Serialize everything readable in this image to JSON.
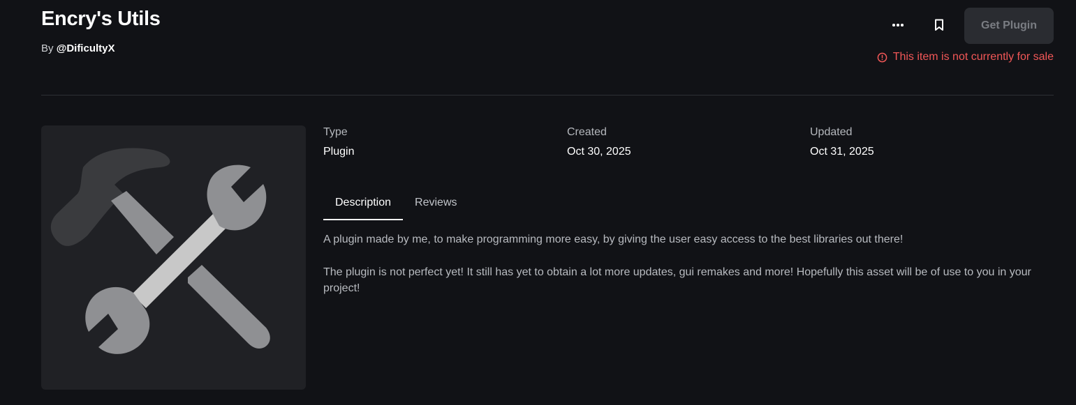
{
  "header": {
    "title": "Encry's Utils",
    "by_prefix": "By",
    "creator": "@DificultyX"
  },
  "actions": {
    "more_icon": "ellipsis-icon",
    "bookmark_icon": "bookmark-icon",
    "get_label": "Get Plugin",
    "sale_warning": "This item is not currently for sale",
    "warning_icon": "alert-circle-icon"
  },
  "details": [
    {
      "label": "Type",
      "value": "Plugin"
    },
    {
      "label": "Created",
      "value": "Oct 30, 2025"
    },
    {
      "label": "Updated",
      "value": "Oct 31, 2025"
    }
  ],
  "tabs": [
    {
      "label": "Description",
      "active": true
    },
    {
      "label": "Reviews",
      "active": false
    }
  ],
  "description": [
    "A plugin made by me, to make programming more easy, by giving the user easy access to the best libraries out there!",
    "The plugin is not perfect yet! It still has yet to obtain a lot more updates, gui remakes and more! Hopefully this asset will be of use to you in your project!"
  ],
  "colors": {
    "background": "#111216",
    "warning": "#f25757",
    "button_bg": "#2a2c31"
  }
}
